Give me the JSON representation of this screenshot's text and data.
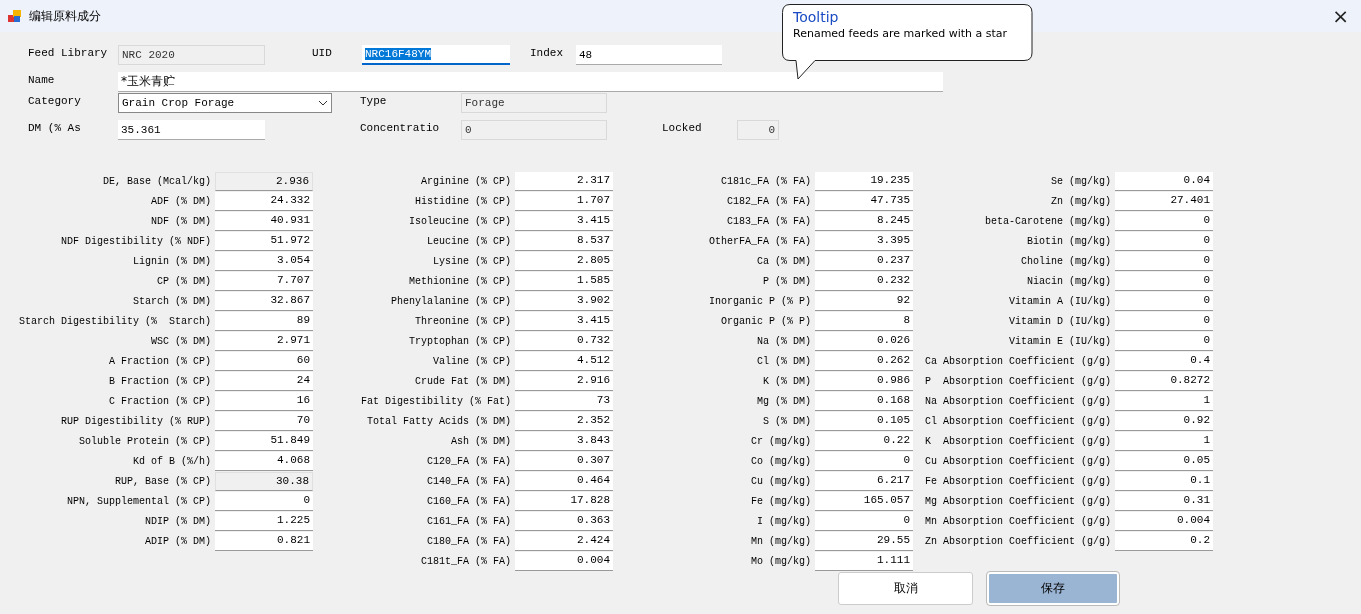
{
  "window": {
    "title": "编辑原料成分",
    "close": "×"
  },
  "header_fields": [
    {
      "label": "Feed Library",
      "value": "NRC 2020",
      "kind": "readonly"
    },
    {
      "label": "UID",
      "value": "NRC16F48YM",
      "kind": "text",
      "highlighted": true
    },
    {
      "label": "Index",
      "value": "48",
      "kind": "text",
      "highlighted": false
    },
    {
      "label": "Name",
      "value": "*玉米青贮",
      "kind": "text",
      "highlighted": false
    },
    {
      "label": "Category",
      "value": "Grain Crop Forage",
      "kind": "dropdown"
    },
    {
      "label": "Type",
      "value": "Forage",
      "kind": "readonly"
    },
    {
      "label": "DM (% As",
      "value": "35.361",
      "kind": "text",
      "highlighted": false
    },
    {
      "label": "Concentratio",
      "value": "0",
      "kind": "readonly"
    },
    {
      "label": "Locked",
      "value": "0",
      "kind": "readonly"
    }
  ],
  "tooltip": {
    "title": "Tooltip",
    "text": "Renamed feeds are marked with a star"
  },
  "columns": [
    [
      {
        "label": "DE, Base (Mcal/kg)",
        "value": "2.936",
        "readonly": true
      },
      {
        "label": "ADF (% DM)",
        "value": "24.332",
        "readonly": false
      },
      {
        "label": "NDF (% DM)",
        "value": "40.931",
        "readonly": false
      },
      {
        "label": "NDF Digestibility (% NDF)",
        "value": "51.972",
        "readonly": false
      },
      {
        "label": "Lignin (% DM)",
        "value": "3.054",
        "readonly": false
      },
      {
        "label": "CP (% DM)",
        "value": "7.707",
        "readonly": false
      },
      {
        "label": "Starch (% DM)",
        "value": "32.867",
        "readonly": false
      },
      {
        "label": "Starch Digestibility (%  Starch)",
        "value": "89",
        "readonly": false
      },
      {
        "label": "WSC (% DM)",
        "value": "2.971",
        "readonly": false
      },
      {
        "label": "A Fraction (% CP)",
        "value": "60",
        "readonly": false
      },
      {
        "label": "B Fraction (% CP)",
        "value": "24",
        "readonly": false
      },
      {
        "label": "C Fraction (% CP)",
        "value": "16",
        "readonly": false
      },
      {
        "label": "RUP Digestibility (% RUP)",
        "value": "70",
        "readonly": false
      },
      {
        "label": "Soluble Protein (% CP)",
        "value": "51.849",
        "readonly": false
      },
      {
        "label": "Kd of B (%/h)",
        "value": "4.068",
        "readonly": false
      },
      {
        "label": "RUP, Base (% CP)",
        "value": "30.38",
        "readonly": true
      },
      {
        "label": "NPN, Supplemental (% CP)",
        "value": "0",
        "readonly": false
      },
      {
        "label": "NDIP (% DM)",
        "value": "1.225",
        "readonly": false
      },
      {
        "label": "ADIP (% DM)",
        "value": "0.821",
        "readonly": false
      }
    ],
    [
      {
        "label": "Arginine (% CP)",
        "value": "2.317",
        "readonly": false
      },
      {
        "label": "Histidine (% CP)",
        "value": "1.707",
        "readonly": false
      },
      {
        "label": "Isoleucine (% CP)",
        "value": "3.415",
        "readonly": false
      },
      {
        "label": "Leucine (% CP)",
        "value": "8.537",
        "readonly": false
      },
      {
        "label": "Lysine (% CP)",
        "value": "2.805",
        "readonly": false
      },
      {
        "label": "Methionine (% CP)",
        "value": "1.585",
        "readonly": false
      },
      {
        "label": "Phenylalanine (% CP)",
        "value": "3.902",
        "readonly": false
      },
      {
        "label": "Threonine (% CP)",
        "value": "3.415",
        "readonly": false
      },
      {
        "label": "Tryptophan (% CP)",
        "value": "0.732",
        "readonly": false
      },
      {
        "label": "Valine (% CP)",
        "value": "4.512",
        "readonly": false
      },
      {
        "label": "Crude Fat (% DM)",
        "value": "2.916",
        "readonly": false
      },
      {
        "label": "Fat Digestibility (% Fat)",
        "value": "73",
        "readonly": false
      },
      {
        "label": "Total Fatty Acids (% DM)",
        "value": "2.352",
        "readonly": false
      },
      {
        "label": "Ash (% DM)",
        "value": "3.843",
        "readonly": false
      },
      {
        "label": "C120_FA (% FA)",
        "value": "0.307",
        "readonly": false
      },
      {
        "label": "C140_FA (% FA)",
        "value": "0.464",
        "readonly": false
      },
      {
        "label": "C160_FA (% FA)",
        "value": "17.828",
        "readonly": false
      },
      {
        "label": "C161_FA (% FA)",
        "value": "0.363",
        "readonly": false
      },
      {
        "label": "C180_FA (% FA)",
        "value": "2.424",
        "readonly": false
      },
      {
        "label": "C181t_FA (% FA)",
        "value": "0.004",
        "readonly": false
      }
    ],
    [
      {
        "label": "C181c_FA (% FA)",
        "value": "19.235",
        "readonly": false
      },
      {
        "label": "C182_FA (% FA)",
        "value": "47.735",
        "readonly": false
      },
      {
        "label": "C183_FA (% FA)",
        "value": "8.245",
        "readonly": false
      },
      {
        "label": "OtherFA_FA (% FA)",
        "value": "3.395",
        "readonly": false
      },
      {
        "label": "Ca (% DM)",
        "value": "0.237",
        "readonly": false
      },
      {
        "label": "P (% DM)",
        "value": "0.232",
        "readonly": false
      },
      {
        "label": "Inorganic P (% P)",
        "value": "92",
        "readonly": false
      },
      {
        "label": "Organic P (% P)",
        "value": "8",
        "readonly": false
      },
      {
        "label": "Na (% DM)",
        "value": "0.026",
        "readonly": false
      },
      {
        "label": "Cl (% DM)",
        "value": "0.262",
        "readonly": false
      },
      {
        "label": "K (% DM)",
        "value": "0.986",
        "readonly": false
      },
      {
        "label": "Mg (% DM)",
        "value": "0.168",
        "readonly": false
      },
      {
        "label": "S (% DM)",
        "value": "0.105",
        "readonly": false
      },
      {
        "label": "Cr (mg/kg)",
        "value": "0.22",
        "readonly": false
      },
      {
        "label": "Co (mg/kg)",
        "value": "0",
        "readonly": false
      },
      {
        "label": "Cu (mg/kg)",
        "value": "6.217",
        "readonly": false
      },
      {
        "label": "Fe (mg/kg)",
        "value": "165.057",
        "readonly": false
      },
      {
        "label": "I (mg/kg)",
        "value": "0",
        "readonly": false
      },
      {
        "label": "Mn (mg/kg)",
        "value": "29.55",
        "readonly": false
      },
      {
        "label": "Mo (mg/kg)",
        "value": "1.111",
        "readonly": false
      }
    ],
    [
      {
        "label": "Se (mg/kg)",
        "value": "0.04",
        "readonly": false
      },
      {
        "label": "Zn (mg/kg)",
        "value": "27.401",
        "readonly": false
      },
      {
        "label": "beta-Carotene (mg/kg)",
        "value": "0",
        "readonly": false
      },
      {
        "label": "Biotin (mg/kg)",
        "value": "0",
        "readonly": false
      },
      {
        "label": "Choline (mg/kg)",
        "value": "0",
        "readonly": false
      },
      {
        "label": "Niacin (mg/kg)",
        "value": "0",
        "readonly": false
      },
      {
        "label": "Vitamin A (IU/kg)",
        "value": "0",
        "readonly": false
      },
      {
        "label": "Vitamin D (IU/kg)",
        "value": "0",
        "readonly": false
      },
      {
        "label": "Vitamin E (IU/kg)",
        "value": "0",
        "readonly": false
      },
      {
        "label": "Ca Absorption Coefficient (g/g)",
        "value": "0.4",
        "readonly": false
      },
      {
        "label": "P  Absorption Coefficient (g/g)",
        "value": "0.8272",
        "readonly": false
      },
      {
        "label": "Na Absorption Coefficient (g/g)",
        "value": "1",
        "readonly": false
      },
      {
        "label": "Cl Absorption Coefficient (g/g)",
        "value": "0.92",
        "readonly": false
      },
      {
        "label": "K  Absorption Coefficient (g/g)",
        "value": "1",
        "readonly": false
      },
      {
        "label": "Cu Absorption Coefficient (g/g)",
        "value": "0.05",
        "readonly": false
      },
      {
        "label": "Fe Absorption Coefficient (g/g)",
        "value": "0.1",
        "readonly": false
      },
      {
        "label": "Mg Absorption Coefficient (g/g)",
        "value": "0.31",
        "readonly": false
      },
      {
        "label": "Mn Absorption Coefficient (g/g)",
        "value": "0.004",
        "readonly": false
      },
      {
        "label": "Zn Absorption Coefficient (g/g)",
        "value": "0.2",
        "readonly": false
      }
    ]
  ],
  "buttons": [
    {
      "label": "取消",
      "default": false
    },
    {
      "label": "保存",
      "default": true
    }
  ]
}
